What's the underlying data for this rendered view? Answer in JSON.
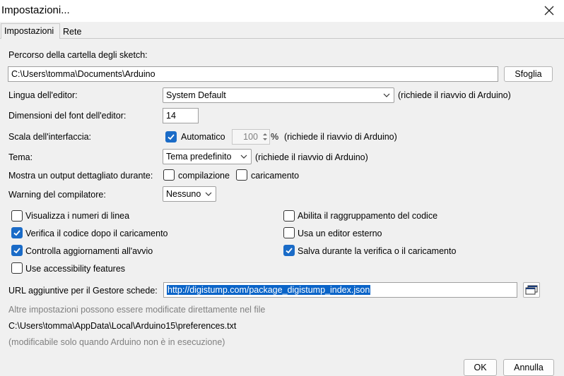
{
  "window": {
    "title": "Impostazioni..."
  },
  "tabs": [
    {
      "label": "Impostazioni"
    },
    {
      "label": "Rete"
    }
  ],
  "sketchbook": {
    "label": "Percorso della cartella degli sketch:",
    "path": "C:\\Users\\tomma\\Documents\\Arduino",
    "browse_label": "Sfoglia"
  },
  "editor_language": {
    "label": "Lingua dell'editor:",
    "value": "System Default",
    "note": "(richiede il riavvio di Arduino)"
  },
  "font_size": {
    "label": "Dimensioni del font dell'editor:",
    "value": "14"
  },
  "interface_scale": {
    "label": "Scala dell'interfaccia:",
    "auto_label": "Automatico",
    "auto_checked": true,
    "value": "100",
    "unit": "%",
    "note": "(richiede il riavvio di Arduino)"
  },
  "theme": {
    "label": "Tema:",
    "value": "Tema predefinito",
    "note": "(richiede il riavvio di Arduino)"
  },
  "verbose": {
    "label": "Mostra un output dettagliato durante:",
    "compile_label": "compilazione",
    "upload_label": "caricamento"
  },
  "warnings": {
    "label": "Warning del compilatore:",
    "value": "Nessuno"
  },
  "options_left": [
    {
      "label": "Visualizza i numeri di linea",
      "checked": false
    },
    {
      "label": "Verifica il codice dopo il caricamento",
      "checked": true
    },
    {
      "label": "Controlla aggiornamenti all'avvio",
      "checked": true
    },
    {
      "label": "Use accessibility features",
      "checked": false
    }
  ],
  "options_right": [
    {
      "label": "Abilita il raggruppamento del codice",
      "checked": false
    },
    {
      "label": "Usa un editor esterno",
      "checked": false
    },
    {
      "label": "Salva durante la verifica o il caricamento",
      "checked": true
    }
  ],
  "board_urls": {
    "label": "URL aggiuntive per il Gestore schede:",
    "value": "http://digistump.com/package_digistump_index.json"
  },
  "footer": {
    "more_prefs": "Altre impostazioni possono essere modificate direttamente nel file",
    "prefs_path": "C:\\Users\\tomma\\AppData\\Local\\Arduino15\\preferences.txt",
    "edit_note": "(modificabile solo quando Arduino non è in esecuzione)"
  },
  "buttons": {
    "ok": "OK",
    "cancel": "Annulla"
  },
  "colors": {
    "accent": "#1a6bc7",
    "selection": "#0a64c8",
    "hint": "#808080"
  }
}
